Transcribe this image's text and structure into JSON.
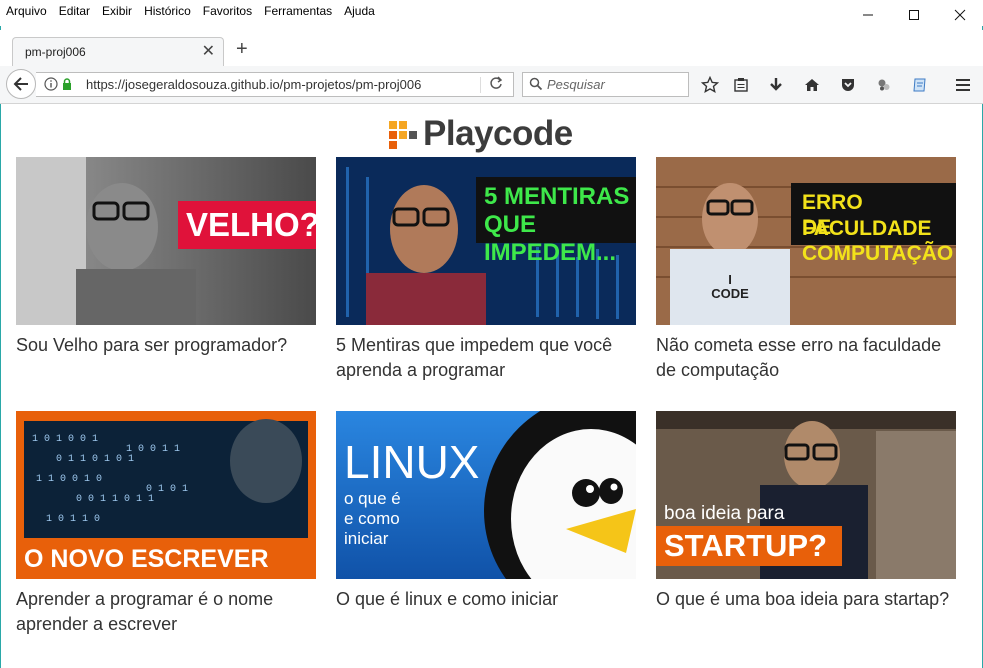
{
  "menu": [
    "Arquivo",
    "Editar",
    "Exibir",
    "Histórico",
    "Favoritos",
    "Ferramentas",
    "Ajuda"
  ],
  "tab": {
    "title": "pm-proj006"
  },
  "url": {
    "text": "https://josegeraldosouza.github.io/pm-projetos/pm-proj006"
  },
  "search": {
    "placeholder": "Pesquisar"
  },
  "logo": {
    "text": "Playcode"
  },
  "videos": [
    {
      "title": "Sou Velho para ser programador?",
      "badge": "VELHO?!"
    },
    {
      "title": "5 Mentiras que impedem que você aprenda a programar",
      "badge_line1": "5 MENTIRAS",
      "badge_line2": "QUE IMPEDEM..."
    },
    {
      "title": "Não cometa esse erro na faculdade de computação",
      "badge_line1": "ERRO FACULDADE",
      "badge_line2": "DE COMPUTAÇÃO",
      "shirt": "I CODE"
    },
    {
      "title": "Aprender a programar é o nome aprender a escrever",
      "badge": "O NOVO ESCREVER"
    },
    {
      "title": "O que é linux e como iniciar",
      "badge": "LINUX",
      "badge_sub": "o que é\ne como\niniciar"
    },
    {
      "title": "O que é uma boa ideia para startap?",
      "badge_line1": "boa ideia para",
      "badge_line2": "STARTUP?"
    }
  ],
  "colors": {
    "accent_red": "#e0123a",
    "accent_orange": "#e8600a",
    "accent_yellow": "#f2e21a",
    "accent_green": "#3ee84a",
    "linux_blue": "#1e6ec0"
  }
}
